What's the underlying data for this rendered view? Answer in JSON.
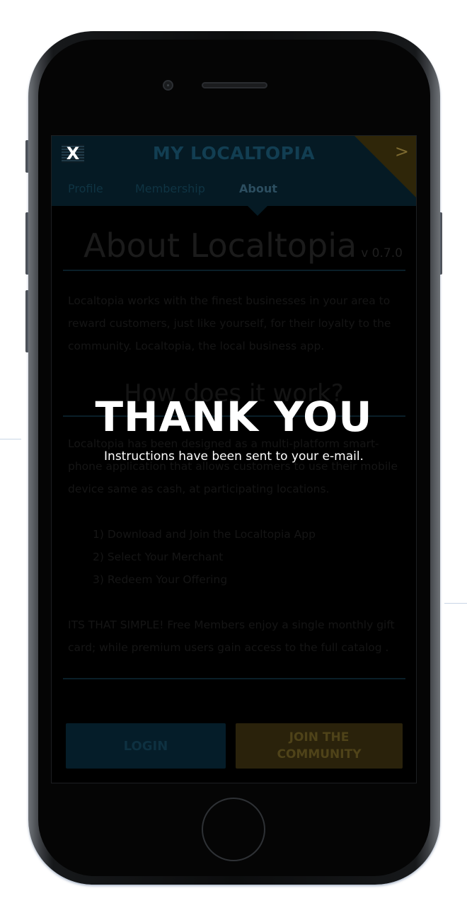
{
  "header": {
    "title": "MY LOCALTOPIA",
    "close_label": "X",
    "next_arrow": ">"
  },
  "tabs": [
    {
      "label": "Profile"
    },
    {
      "label": "Membership"
    },
    {
      "label": "About",
      "active": true
    }
  ],
  "about": {
    "title": "About Localtopia",
    "version": "v 0.7.0",
    "intro": "Localtopia works with the finest businesses in your area to reward customers, just like yourself, for their loyalty to the community. Localtopia, the local business app.",
    "how_title": "How does it work?",
    "how_text": "Localtopia has been designed as a multi-platform smart-phone application that allows customers to use their mobile device same as cash, at participating locations.",
    "steps": [
      "1)  Download and Join the Localtopia App",
      "2)  Select Your Merchant",
      "3)  Redeem Your Offering"
    ],
    "closing": "ITS THAT SIMPLE! Free Members enjoy a single monthly gift card; while premium users gain access to the full catalog ."
  },
  "buttons": {
    "login": "LOGIN",
    "join": "JOIN THE COMMUNITY"
  },
  "overlay": {
    "heading": "THANK YOU",
    "message": "Instructions have been sent to your e-mail."
  },
  "colors": {
    "header_bg": "#051a24",
    "accent_gold": "#2f2609",
    "overlay_text": "#ffffff"
  }
}
